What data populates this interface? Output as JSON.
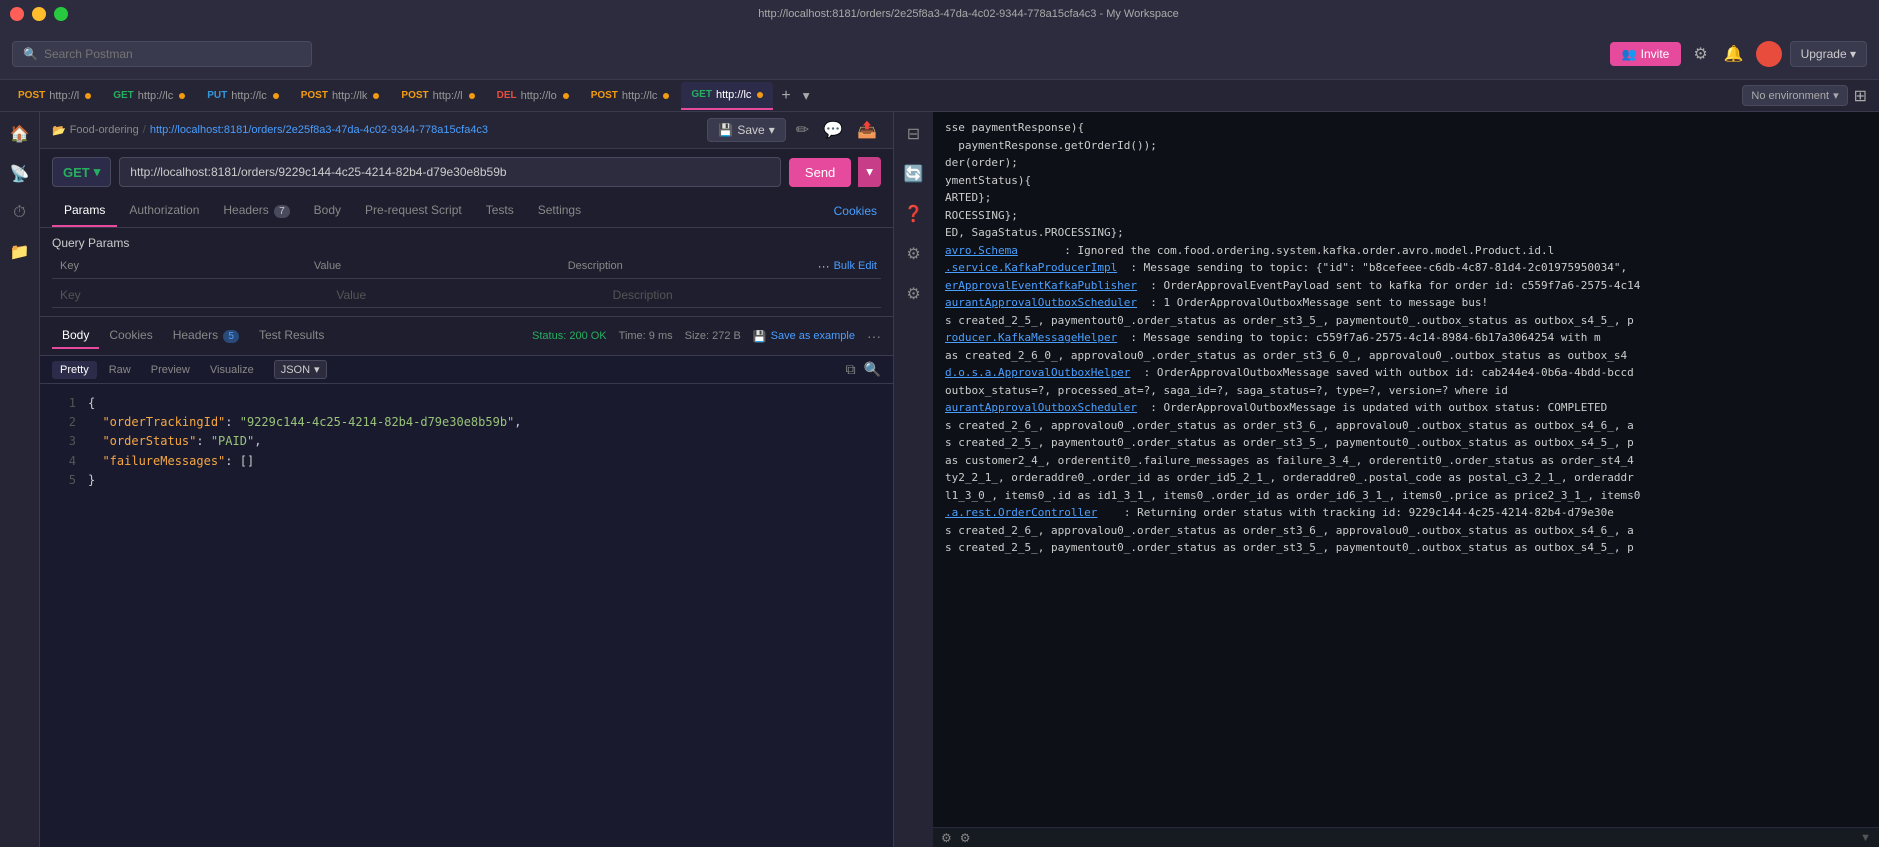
{
  "titlebar": {
    "title": "http://localhost:8181/orders/2e25f8a3-47da-4c02-9344-778a15cfa4c3 - My Workspace",
    "controls": [
      "close",
      "minimize",
      "maximize"
    ]
  },
  "topbar": {
    "search_placeholder": "Search Postman",
    "invite_label": "Invite",
    "upgrade_label": "Upgrade",
    "upgrade_arrow": "▾"
  },
  "tabs": [
    {
      "method": "POST",
      "url": "http://l",
      "active": false,
      "dot": "orange"
    },
    {
      "method": "GET",
      "url": "http://lc",
      "active": false,
      "dot": "orange"
    },
    {
      "method": "PUT",
      "url": "http://lc",
      "active": false,
      "dot": "orange"
    },
    {
      "method": "POST",
      "url": "http://lk",
      "active": false,
      "dot": "orange"
    },
    {
      "method": "POST",
      "url": "http://l",
      "active": false,
      "dot": "orange"
    },
    {
      "method": "DEL",
      "url": "http://lo",
      "active": false,
      "dot": "orange"
    },
    {
      "method": "POST",
      "url": "http://lc",
      "active": false,
      "dot": "orange"
    },
    {
      "method": "GET",
      "url": "http://lc",
      "active": true,
      "dot": "orange"
    }
  ],
  "env_selector": {
    "label": "No environment",
    "arrow": "▾"
  },
  "request_header": {
    "breadcrumb_folder": "Food-ordering",
    "breadcrumb_sep": "/",
    "breadcrumb_url": "http://localhost:8181/orders/2e25f8a3-47da-4c02-9344-778a15cfa4c3",
    "save_label": "Save",
    "save_arrow": "▾"
  },
  "url_bar": {
    "method": "GET",
    "url": "http://localhost:8181/orders/9229c144-4c25-4214-82b4-d79e30e8b59b",
    "send_label": "Send"
  },
  "nav_tabs": {
    "tabs": [
      {
        "label": "Params",
        "active": true,
        "badge": null
      },
      {
        "label": "Authorization",
        "active": false,
        "badge": null
      },
      {
        "label": "Headers",
        "active": false,
        "badge": "7"
      },
      {
        "label": "Body",
        "active": false,
        "badge": null
      },
      {
        "label": "Pre-request Script",
        "active": false,
        "badge": null
      },
      {
        "label": "Tests",
        "active": false,
        "badge": null
      },
      {
        "label": "Settings",
        "active": false,
        "badge": null
      }
    ],
    "cookies_label": "Cookies"
  },
  "query_params": {
    "title": "Query Params",
    "columns": [
      "Key",
      "Value",
      "Description"
    ],
    "bulk_edit": "Bulk Edit",
    "key_placeholder": "Key",
    "value_placeholder": "Value",
    "description_placeholder": "Description"
  },
  "response": {
    "tabs": [
      {
        "label": "Body",
        "active": true,
        "badge": null
      },
      {
        "label": "Cookies",
        "active": false,
        "badge": null
      },
      {
        "label": "Headers",
        "active": false,
        "badge": "5"
      },
      {
        "label": "Test Results",
        "active": false,
        "badge": null
      }
    ],
    "status": "Status: 200 OK",
    "time": "Time: 9 ms",
    "size": "Size: 272 B",
    "save_example": "Save as example",
    "format_tabs": [
      {
        "label": "Pretty",
        "active": true
      },
      {
        "label": "Raw",
        "active": false
      },
      {
        "label": "Preview",
        "active": false
      },
      {
        "label": "Visualize",
        "active": false
      }
    ],
    "format": "JSON",
    "json_lines": [
      {
        "num": 1,
        "content": "{",
        "type": "bracket"
      },
      {
        "num": 2,
        "content": "\"orderTrackingId\": \"9229c144-4c25-4214-82b4-d79e30e8b59b\",",
        "type": "kv",
        "key": "orderTrackingId",
        "value": "\"9229c144-4c25-4214-82b4-d79e30e8b59b\""
      },
      {
        "num": 3,
        "content": "\"orderStatus\": \"PAID\",",
        "type": "kv",
        "key": "orderStatus",
        "value": "\"PAID\""
      },
      {
        "num": 4,
        "content": "\"failureMessages\": []",
        "type": "kv",
        "key": "failureMessages",
        "value": "[]"
      },
      {
        "num": 5,
        "content": "}",
        "type": "bracket"
      }
    ]
  },
  "terminal": {
    "lines": [
      {
        "text": "paymentResponse.getOrderId());",
        "class": "t-normal",
        "prefix": "sse paymentResponse){"
      },
      {
        "text": "der(order);",
        "class": "t-normal",
        "prefix": ""
      },
      {
        "text": "ymentStatus){",
        "class": "t-normal",
        "prefix": ""
      },
      {
        "text": "ARTED};",
        "class": "t-normal",
        "prefix": ""
      },
      {
        "text": "ROCESSING};",
        "class": "t-normal",
        "prefix": ""
      },
      {
        "text": "ED, SagaStatus.PROCESSING};",
        "class": "t-normal",
        "prefix": ""
      },
      {
        "link": "avro.Schema",
        "suffix": ": Ignored the com.food.ordering.system.kafka.order.avro.model.Product.id.l"
      },
      {
        "link": ".service.KafkaProducerImpl",
        "suffix": ": Message sending to topic: {\"id\": \"b8cefeee-c6db-4c87-81d4-2c01975950034\","
      },
      {
        "link": "erApprovalEventKafkaPublisher",
        "suffix": ": OrderApprovalEventPayload sent to kafka for order id: c559f7a6-2575-4c14"
      },
      {
        "link": "aurantApprovalOutboxScheduler",
        "suffix": ": 1 OrderApprovalOutboxMessage sent to message bus!"
      },
      {
        "text": "s created_2_5_, paymentout0_.order_status as order_st3_5_, paymentout0_.outbox_status as outbox_s4_5_, p",
        "class": "t-normal"
      },
      {
        "link": "roducer.KafkaMessageHelper",
        "suffix": ": Message sending to topic: c559f7a6-2575-4c14-8984-6b17a3064254 with m"
      },
      {
        "text": "as created_2_6_0_, approvalou0_.order_status as order_st3_6_0_, approvalou0_.outbox_status as outbox_s4",
        "class": "t-normal"
      },
      {
        "link": "d.o.s.a.ApprovalOutboxHelper",
        "suffix": ": OrderApprovalOutboxMessage saved with outbox id: cab244e4-0b6a-4bdd-bccd"
      },
      {
        "text": "outbox_status=?, processed_at=?, saga_id=?, saga_status=?, type=?, version=? where id",
        "class": "t-normal"
      },
      {
        "link": "aurantApprovalOutboxScheduler",
        "suffix": ": OrderApprovalOutboxMessage is updated with outbox status: COMPLETED"
      },
      {
        "text": "s created_2_6_, approvalou0_.order_status as order_st3_6_, approvalou0_.outbox_status as outbox_s4_6_, a",
        "class": "t-normal"
      },
      {
        "text": "s created_2_5_, paymentout0_.order_status as order_st3_5_, paymentout0_.outbox_status as outbox_s4_5_, p",
        "class": "t-normal"
      },
      {
        "text": "as customer2_4_, orderentit0_.failure_messages as failure_3_4_, orderentit0_.order_status as order_st4_4",
        "class": "t-normal"
      },
      {
        "text": "ty2_2_1_, orderaddre0_.order_id as order_id5_2_1_, orderaddre0_.postal_code as postal_c3_2_1_, orderaddr",
        "class": "t-normal"
      },
      {
        "text": "l1_3_0_, items0_.id as id1_3_1_, items0_.order_id as order_id6_3_1_, items0_.price as price2_3_1_, items0",
        "class": "t-normal"
      },
      {
        "link": ".a.rest.OrderController",
        "suffix": ": Returning order status with tracking id: 9229c144-4c25-4214-82b4-d79e30e"
      },
      {
        "text": "s created_2_6_, approvalou0_.order_status as order_st3_6_, approvalou0_.outbox_status as outbox_s4_6_, a",
        "class": "t-normal"
      },
      {
        "text": "s created_2_5_, paymentout0_.order_status as order_st3_5_, paymentout0_.outbox_status as outbox_s4_5_, p",
        "class": "t-normal"
      }
    ]
  }
}
